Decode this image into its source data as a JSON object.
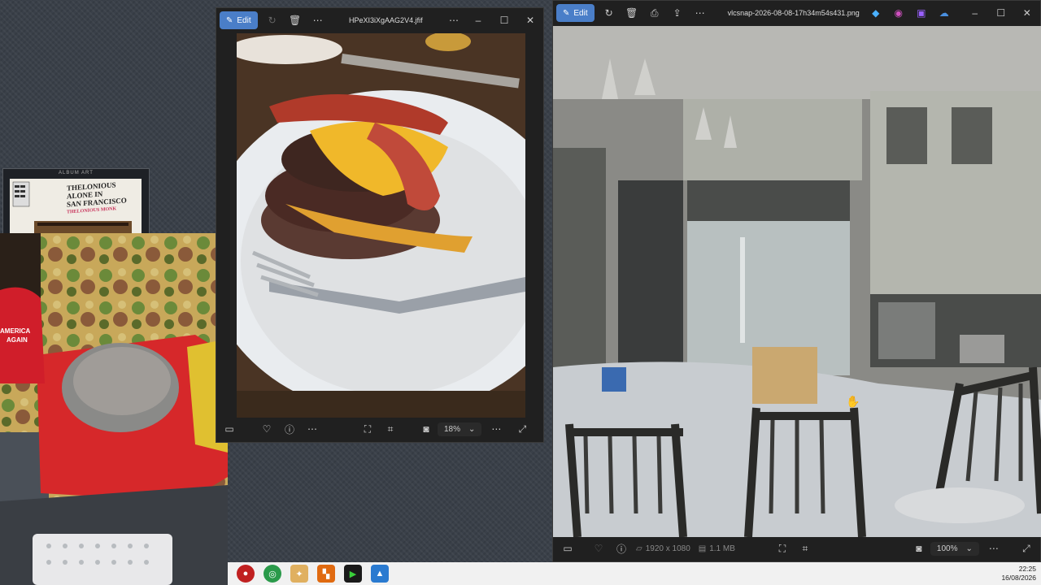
{
  "album_widget": {
    "title": "ALBUM ART",
    "cover_line1": "THELONIOUS",
    "cover_line2": "ALONE IN",
    "cover_line3": "SAN FRANCISCO",
    "cover_sub": "THELONIOUS MONK"
  },
  "cam_overlay": {
    "hat_text_1": "AMERICA",
    "hat_text_2": "AGAIN"
  },
  "window_left": {
    "edit_label": "Edit",
    "filename": "HPeXI3iXgAAG2V4.jfif",
    "zoom_value": "18%",
    "icons": [
      "edit-icon",
      "rotate-icon",
      "delete-icon",
      "more-icon",
      "minimize-icon",
      "maximize-icon",
      "close-icon",
      "filmstrip-icon",
      "favorite-icon",
      "info-icon",
      "more-icon",
      "fit-icon",
      "scan-icon",
      "slideshow-icon",
      "chevron-down-icon",
      "expand-icon"
    ]
  },
  "window_right": {
    "edit_label": "Edit",
    "filename": "vlcsnap-2026-08-08-17h34m54s431.png",
    "dimensions": "1920 x 1080",
    "file_size": "1.1 MB",
    "zoom_value": "100%",
    "icons": [
      "edit-icon",
      "rotate-icon",
      "delete-icon",
      "print-icon",
      "share-icon",
      "more-icon",
      "minimize-icon",
      "maximize-icon",
      "close-icon",
      "filmstrip-icon",
      "favorite-icon",
      "info-icon",
      "fit-icon",
      "scan-icon",
      "chevron-down-icon",
      "expand-icon"
    ]
  },
  "taskbar": {
    "apps": [
      "red-app-icon",
      "chrome-icon",
      "pinwheel-icon",
      "orange-app-icon",
      "terminal-icon",
      "photos-icon"
    ],
    "time": "22:25",
    "date": "16/08/2026"
  },
  "colors": {
    "accent": "#4a7ec8",
    "window_bg": "#202020",
    "taskbar_bg": "#f1f1f1"
  }
}
